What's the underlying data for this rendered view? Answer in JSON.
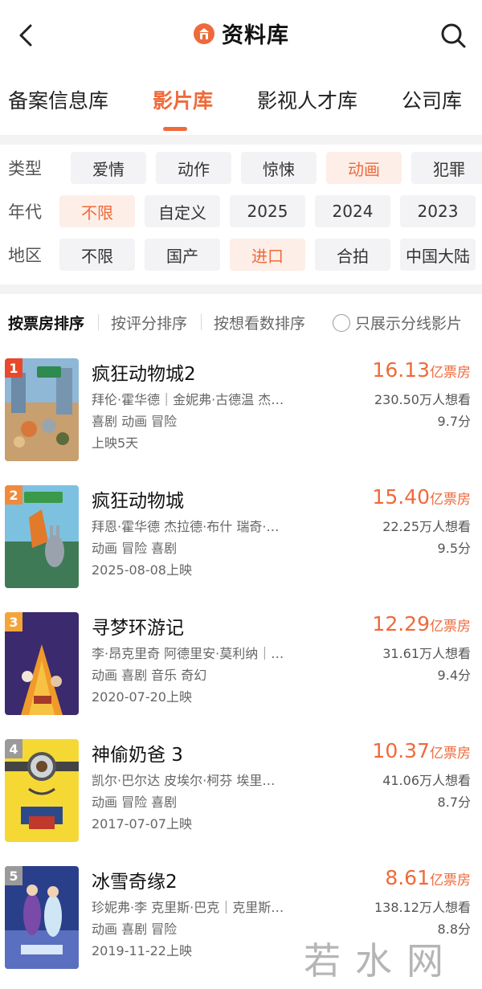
{
  "header": {
    "title": "资料库",
    "accent": "#ef6a3a"
  },
  "tabs": [
    {
      "label": "备案信息库",
      "active": false
    },
    {
      "label": "影片库",
      "active": true
    },
    {
      "label": "影视人才库",
      "active": false
    },
    {
      "label": "公司库",
      "active": false
    }
  ],
  "filters": {
    "type": {
      "label": "类型",
      "options": [
        "爱情",
        "动作",
        "惊悚",
        "动画",
        "犯罪"
      ],
      "selected": "动画"
    },
    "year": {
      "label": "年代",
      "options": [
        "不限",
        "自定义",
        "2025",
        "2024",
        "2023"
      ],
      "selected": "不限"
    },
    "region": {
      "label": "地区",
      "options": [
        "不限",
        "国产",
        "进口",
        "合拍",
        "中国大陆"
      ],
      "selected": "进口"
    }
  },
  "sort": {
    "options": [
      "按票房排序",
      "按评分排序",
      "按想看数排序"
    ],
    "active": "按票房排序",
    "toggle_label": "只展示分线影片"
  },
  "movies": [
    {
      "rank": "1",
      "name": "疯狂动物城2",
      "cast": "拜伦·霍华德｜金妮弗·古德温 杰…",
      "genres": "喜剧 动画 冒险",
      "release": "上映5天",
      "box": "16.13",
      "box_unit": "亿票房",
      "want": "230.50万人想看",
      "score": "9.7分",
      "rank_color": "#e8492c"
    },
    {
      "rank": "2",
      "name": "疯狂动物城",
      "cast": "拜恩·霍华德 杰拉德·布什 瑞奇·…",
      "genres": "动画 冒险 喜剧",
      "release": "2025-08-08上映",
      "box": "15.40",
      "box_unit": "亿票房",
      "want": "22.25万人想看",
      "score": "9.5分",
      "rank_color": "#f08a3c"
    },
    {
      "rank": "3",
      "name": "寻梦环游记",
      "cast": "李·昂克里奇 阿德里安·莫利纳｜…",
      "genres": "动画 喜剧 音乐 奇幻",
      "release": "2020-07-20上映",
      "box": "12.29",
      "box_unit": "亿票房",
      "want": "31.61万人想看",
      "score": "9.4分",
      "rank_color": "#f4a53a"
    },
    {
      "rank": "4",
      "name": "神偷奶爸 3",
      "cast": "凯尔·巴尔达 皮埃尔·柯芬 埃里…",
      "genres": "动画 冒险 喜剧",
      "release": "2017-07-07上映",
      "box": "10.37",
      "box_unit": "亿票房",
      "want": "41.06万人想看",
      "score": "8.7分",
      "rank_color": "#9a9a9a"
    },
    {
      "rank": "5",
      "name": "冰雪奇缘2",
      "cast": "珍妮弗·李 克里斯·巴克｜克里斯…",
      "genres": "动画 喜剧 冒险",
      "release": "2019-11-22上映",
      "box": "8.61",
      "box_unit": "亿票房",
      "want": "138.12万人想看",
      "score": "8.8分",
      "rank_color": "#9a9a9a"
    }
  ],
  "watermark": "若水网"
}
